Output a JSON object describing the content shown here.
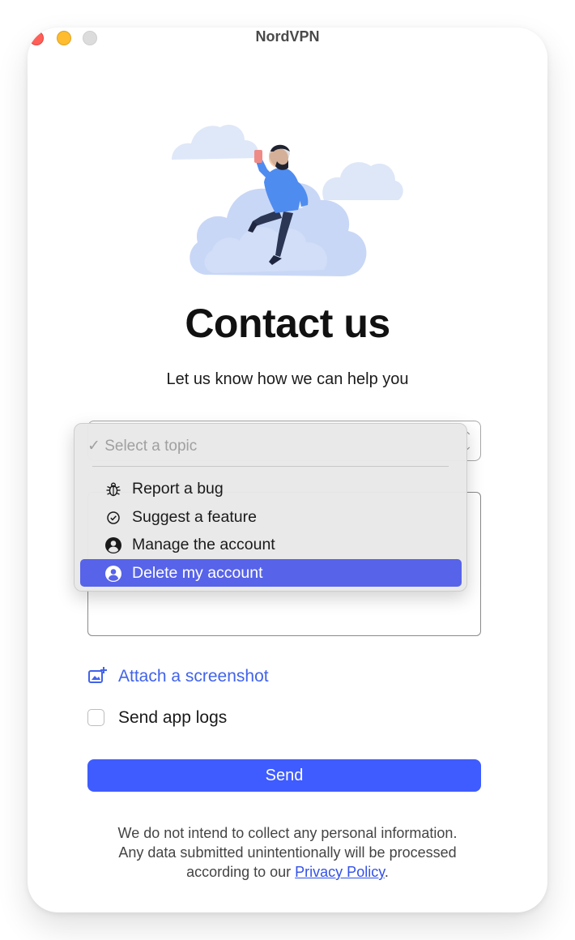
{
  "window": {
    "title": "NordVPN"
  },
  "page": {
    "heading": "Contact us",
    "subheading": "Let us know how we can help you"
  },
  "topic_dropdown": {
    "placeholder": "Select a topic",
    "checkmark": "✓",
    "options": [
      {
        "label": "Report a bug",
        "icon": "bug-icon",
        "selected": false
      },
      {
        "label": "Suggest a feature",
        "icon": "check-circle-icon",
        "selected": false
      },
      {
        "label": "Manage the account",
        "icon": "account-circle-icon",
        "selected": false
      },
      {
        "label": "Delete my account",
        "icon": "account-circle-icon",
        "selected": true
      }
    ]
  },
  "form": {
    "attach_label": "Attach a screenshot",
    "logs_label": "Send app logs",
    "logs_checked": false,
    "send_label": "Send"
  },
  "footer": {
    "line1": "We do not intend to collect any personal information.",
    "line2": "Any data submitted unintentionally will be processed",
    "line3_prefix": "according to our ",
    "privacy_link": "Privacy Policy",
    "line3_suffix": "."
  },
  "colors": {
    "accent": "#3e5cff",
    "link": "#4163ea",
    "selected_item": "#5763e8"
  }
}
